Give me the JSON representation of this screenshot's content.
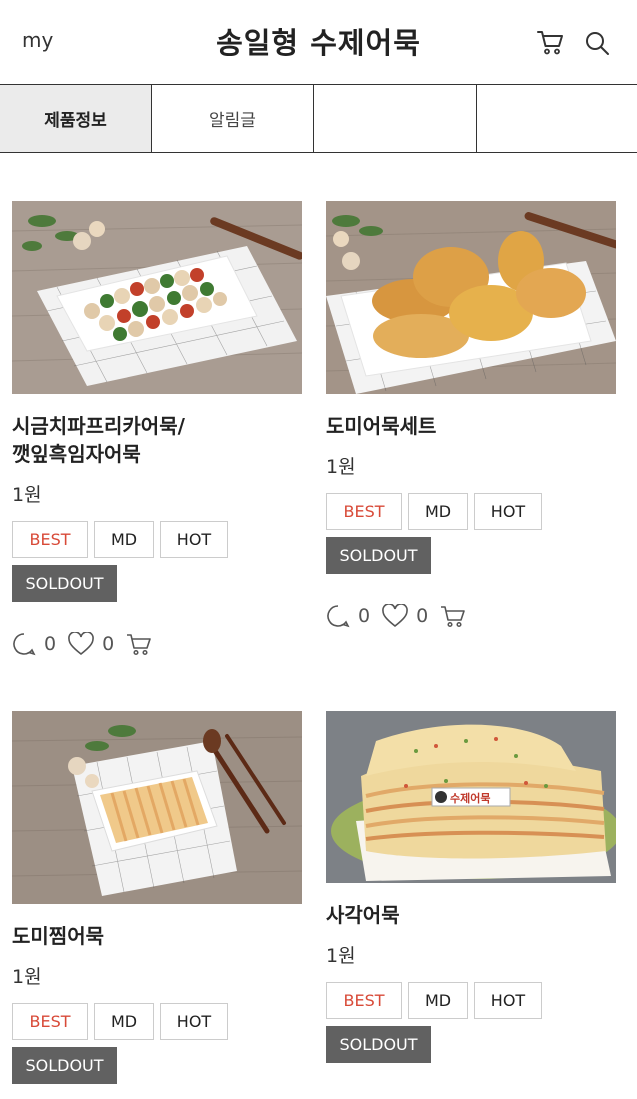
{
  "header": {
    "my_label": "my",
    "title": "송일형 수제어묵"
  },
  "tabs": [
    {
      "label": "제품정보",
      "active": true
    },
    {
      "label": "알림글",
      "active": false
    },
    {
      "label": "",
      "active": false
    },
    {
      "label": "",
      "active": false
    }
  ],
  "products": [
    {
      "name_line1": "시금치파프리카어묵/",
      "name_line2": "깻잎흑임자어묵",
      "price": "1원",
      "badges": {
        "best": "BEST",
        "md": "MD",
        "hot": "HOT"
      },
      "soldout": "SOLDOUT",
      "comments": "0",
      "likes": "0"
    },
    {
      "name_line1": "도미어묵세트",
      "name_line2": "",
      "price": "1원",
      "badges": {
        "best": "BEST",
        "md": "MD",
        "hot": "HOT"
      },
      "soldout": "SOLDOUT",
      "comments": "0",
      "likes": "0"
    },
    {
      "name_line1": "도미찜어묵",
      "name_line2": "",
      "price": "1원",
      "badges": {
        "best": "BEST",
        "md": "MD",
        "hot": "HOT"
      },
      "soldout": "SOLDOUT",
      "comments": "",
      "likes": ""
    },
    {
      "name_line1": "사각어묵",
      "name_line2": "",
      "price": "1원",
      "badges": {
        "best": "BEST",
        "md": "MD",
        "hot": "HOT"
      },
      "soldout": "SOLDOUT",
      "comments": "",
      "likes": ""
    }
  ],
  "image_label": "수제어묵",
  "icons": [
    "cart-icon",
    "search-icon",
    "comment-icon",
    "heart-icon"
  ],
  "colors": {
    "best": "#d84a38",
    "soldout_bg": "#616161",
    "tab_active_bg": "#ebebeb"
  }
}
